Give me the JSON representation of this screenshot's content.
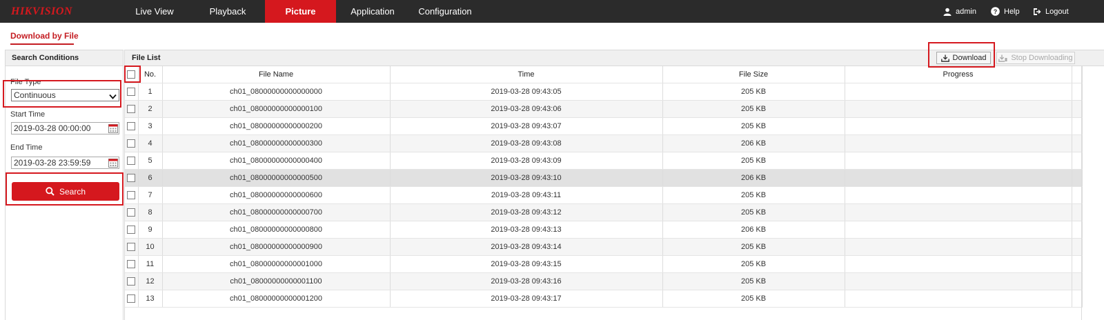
{
  "brand": {
    "logo_text": "HIKVISION"
  },
  "nav": {
    "items": [
      {
        "label": "Live View",
        "active": false
      },
      {
        "label": "Playback",
        "active": false
      },
      {
        "label": "Picture",
        "active": true
      },
      {
        "label": "Application",
        "active": false
      },
      {
        "label": "Configuration",
        "active": false
      }
    ],
    "user_label": "admin",
    "help_label": "Help",
    "logout_label": "Logout"
  },
  "page": {
    "tab_label": "Download by File"
  },
  "search": {
    "header": "Search Conditions",
    "file_type_label": "File Type",
    "file_type_value": "Continuous",
    "start_time_label": "Start Time",
    "start_time_value": "2019-03-28 00:00:00",
    "end_time_label": "End Time",
    "end_time_value": "2019-03-28 23:59:59",
    "search_button": "Search"
  },
  "file_list": {
    "title": "File List",
    "download_button": "Download",
    "stop_button": "Stop Downloading",
    "columns": [
      "No.",
      "File Name",
      "Time",
      "File Size",
      "Progress"
    ],
    "rows": [
      {
        "no": "1",
        "name": "ch01_08000000000000000",
        "time": "2019-03-28 09:43:05",
        "size": "205 KB",
        "progress": ""
      },
      {
        "no": "2",
        "name": "ch01_08000000000000100",
        "time": "2019-03-28 09:43:06",
        "size": "205 KB",
        "progress": ""
      },
      {
        "no": "3",
        "name": "ch01_08000000000000200",
        "time": "2019-03-28 09:43:07",
        "size": "205 KB",
        "progress": ""
      },
      {
        "no": "4",
        "name": "ch01_08000000000000300",
        "time": "2019-03-28 09:43:08",
        "size": "206 KB",
        "progress": ""
      },
      {
        "no": "5",
        "name": "ch01_08000000000000400",
        "time": "2019-03-28 09:43:09",
        "size": "205 KB",
        "progress": ""
      },
      {
        "no": "6",
        "name": "ch01_08000000000000500",
        "time": "2019-03-28 09:43:10",
        "size": "206 KB",
        "progress": ""
      },
      {
        "no": "7",
        "name": "ch01_08000000000000600",
        "time": "2019-03-28 09:43:11",
        "size": "205 KB",
        "progress": ""
      },
      {
        "no": "8",
        "name": "ch01_08000000000000700",
        "time": "2019-03-28 09:43:12",
        "size": "205 KB",
        "progress": ""
      },
      {
        "no": "9",
        "name": "ch01_08000000000000800",
        "time": "2019-03-28 09:43:13",
        "size": "206 KB",
        "progress": ""
      },
      {
        "no": "10",
        "name": "ch01_08000000000000900",
        "time": "2019-03-28 09:43:14",
        "size": "205 KB",
        "progress": ""
      },
      {
        "no": "11",
        "name": "ch01_08000000000001000",
        "time": "2019-03-28 09:43:15",
        "size": "205 KB",
        "progress": ""
      },
      {
        "no": "12",
        "name": "ch01_08000000000001100",
        "time": "2019-03-28 09:43:16",
        "size": "205 KB",
        "progress": ""
      },
      {
        "no": "13",
        "name": "ch01_08000000000001200",
        "time": "2019-03-28 09:43:17",
        "size": "205 KB",
        "progress": ""
      }
    ],
    "selected_row_no": "6"
  },
  "colors": {
    "accent": "#d5181e",
    "topbar": "#2b2b2b"
  },
  "icons": [
    "user-icon",
    "help-icon",
    "logout-icon",
    "chevron-down-icon",
    "calendar-icon",
    "search-icon",
    "download-icon",
    "stop-download-icon",
    "checkbox-icon"
  ]
}
